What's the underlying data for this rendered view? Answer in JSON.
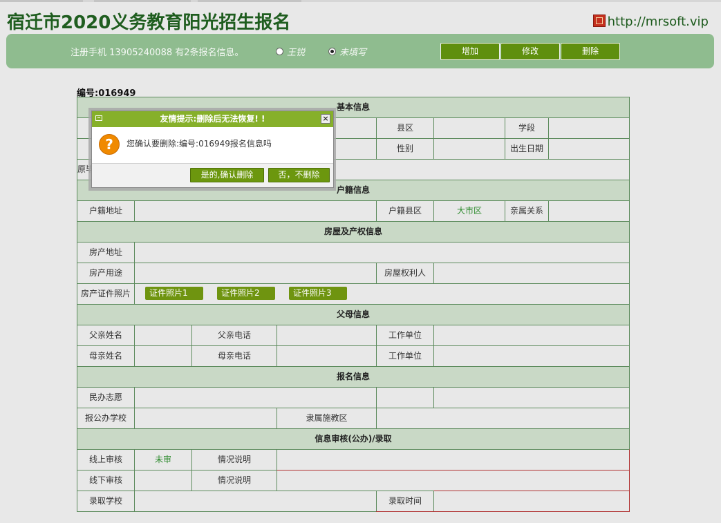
{
  "header": {
    "title": "宿迁市2020义务教育阳光招生报名",
    "site": "http://mrsoft.vip"
  },
  "toolbar": {
    "info": "注册手机 13905240088 有2条报名信息。",
    "options": [
      {
        "label": "王锐",
        "checked": false
      },
      {
        "label": "未填写",
        "checked": true
      }
    ],
    "buttons": [
      "增加",
      "修改",
      "删除"
    ]
  },
  "record": {
    "number": "编号:016949"
  },
  "sections": {
    "basic": "基本信息",
    "huji": "户籍信息",
    "house": "房屋及产权信息",
    "parents": "父母信息",
    "apply": "报名信息",
    "review": "信息审核(公办)/录取"
  },
  "labels": {
    "county": "县区",
    "stage": "学段",
    "gender": "性别",
    "birthday": "出生日期",
    "origin_school": "原毕",
    "huji_address": "户籍地址",
    "huji_county": "户籍县区",
    "huji_county_value": "大市区",
    "relation": "亲属关系",
    "house_address": "房产地址",
    "house_use": "房产用途",
    "house_owner": "房屋权利人",
    "house_photos": "房产证件照片",
    "photo_buttons": [
      "证件照片1",
      "证件照片2",
      "证件照片3"
    ],
    "father_name": "父亲姓名",
    "father_phone": "父亲电话",
    "mother_name": "母亲姓名",
    "mother_phone": "母亲电话",
    "work_unit": "工作单位",
    "private_wish": "民办志愿",
    "public_school": "报公办学校",
    "district": "隶属施教区",
    "online_review": "线上审核",
    "online_review_value": "未审",
    "situation": "情况说明",
    "offline_review": "线下审核",
    "admit_school": "录取学校",
    "admit_time": "录取时间"
  },
  "dialog": {
    "title": "友情提示:删除后无法恢复! !",
    "message": "您确认要删除:编号:016949报名信息吗",
    "confirm": "是的,确认删除",
    "cancel": "否，不删除"
  }
}
